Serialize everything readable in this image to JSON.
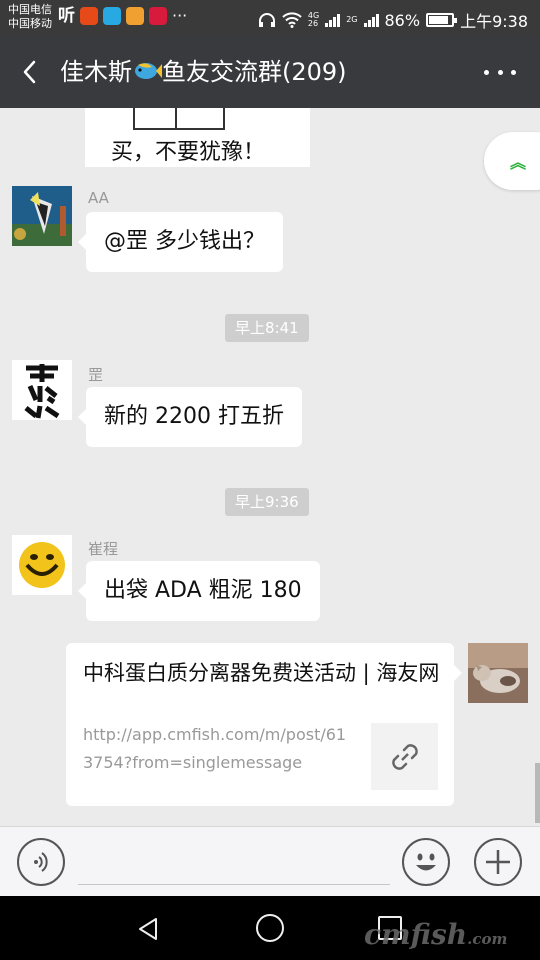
{
  "status_bar": {
    "carrier_1": "中国电信",
    "carrier_2": "中国移动",
    "app_label": "听",
    "net_a_top": "4G",
    "net_a_bottom": "26",
    "net_b": "2G",
    "battery": "86%",
    "time": "上午9:38",
    "icons": [
      "weibo-icon",
      "telegram-icon",
      "app-icon",
      "video-icon",
      "headphone-icon",
      "wifi-icon",
      "signal-icon",
      "battery-icon"
    ]
  },
  "header": {
    "title_prefix": "佳木斯",
    "title_suffix": "鱼友交流群(209)"
  },
  "messages": {
    "image_caption": "买，不要犹豫！",
    "msg1": {
      "sender": "AA",
      "text": "@罡  多少钱出？"
    },
    "time1": "早上8:41",
    "msg2": {
      "sender": "罡",
      "text": "新的 2200  打五折"
    },
    "time2": "早上9:36",
    "msg3": {
      "sender": "崔程",
      "text": "出袋 ADA 粗泥 180"
    },
    "link_card": {
      "title": "中科蛋白质分离器免费送活动 | 海友网",
      "url": "http://app.cmfish.com/m/post/613754?from=singlemessage"
    }
  },
  "input_bar": {
    "value": "",
    "placeholder": ""
  },
  "watermark": {
    "main": "cmfish",
    "suffix": ".com"
  },
  "colors": {
    "header_bg": "#393a3e",
    "chat_bg": "#ebebeb",
    "bubble_bg": "#ffffff",
    "timestamp_bg": "#cecece",
    "accent_green": "#2eaf3c"
  }
}
